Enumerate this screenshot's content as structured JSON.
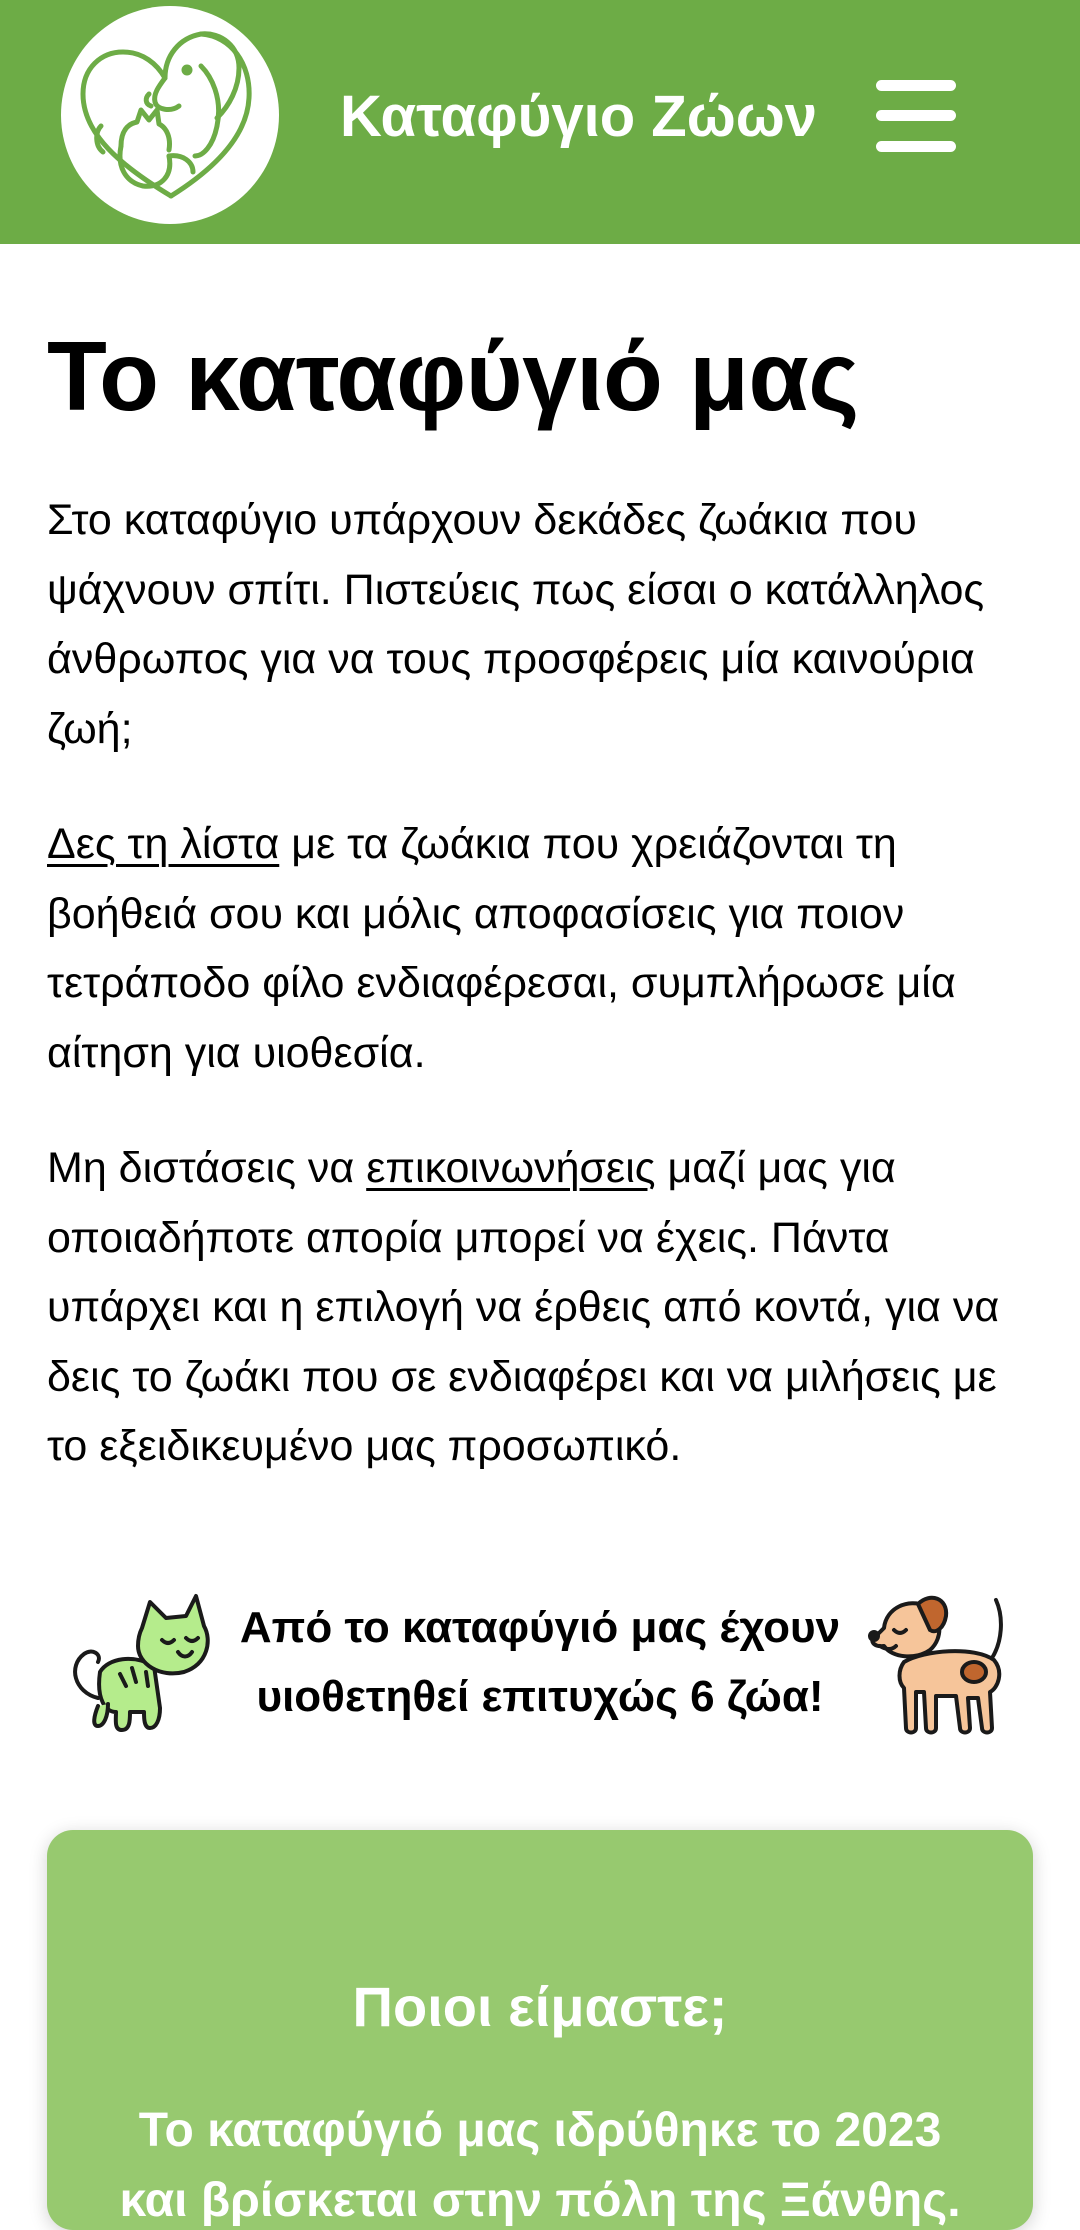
{
  "header": {
    "logo_icon": "dog-and-cat-heart-logo",
    "site_title": "Καταφύγιο Ζώων",
    "menu_icon": "hamburger-menu-icon",
    "bar_color": "#6dac46"
  },
  "main": {
    "title": "Το καταφύγιό μας",
    "p1": "Στο καταφύγιο υπάρχουν δεκάδες ζωάκια που ψάχνουν σπίτι. Πιστεύεις πως είσαι ο κατάλληλος άνθρωπος για να τους προσφέρεις μία καινούρια ζωή;",
    "p2_link": "Δες τη λίστα",
    "p2_rest": " με τα ζωάκια που χρειάζονται τη βοήθειά σου και μόλις αποφασίσεις για ποιον τετράποδο φίλο ενδιαφέρεσαι, συμπλήρωσε μία αίτηση για υιοθεσία.",
    "p3_before": "Μη διστάσεις να ",
    "p3_link": "επικοινωνήσεις",
    "p3_after": " μαζί μας για οποιαδήποτε απορία μπορεί να έχεις. Πάντα υπάρχει και η επιλογή να έρθεις από κοντά, για να δεις το ζωάκι που σε ενδιαφέρει και να μιλήσεις με το εξειδικευμένο μας προσωπικό."
  },
  "adopted": {
    "cat_icon": "green-cat-illustration",
    "dog_icon": "orange-dog-illustration",
    "text": "Από το καταφύγιό μας έχουν υιοθετηθεί επιτυχώς 6 ζώα!"
  },
  "about": {
    "title": "Ποιοι είμαστε;",
    "text": "Το καταφύγιό μας ιδρύθηκε το 2023 και βρίσκεται στην πόλη της Ξάνθης.",
    "card_color": "#97c96f"
  }
}
